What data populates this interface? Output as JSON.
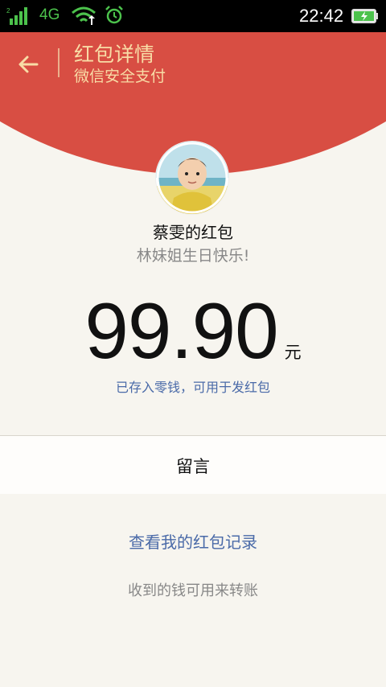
{
  "status_bar": {
    "network": "4G",
    "time": "22:42",
    "icons": [
      "signal-icon",
      "wifi-icon",
      "alarm-icon",
      "battery-charging-icon"
    ]
  },
  "header": {
    "title": "红包详情",
    "subtitle": "微信安全支付",
    "back_icon": "back-arrow-icon",
    "color": "#d84e43",
    "text_color": "#f8dca6"
  },
  "envelope": {
    "avatar": "avatar",
    "sender": "蔡雯的红包",
    "greeting": "林妹姐生日快乐!",
    "amount": "99.90",
    "unit": "元",
    "note": "已存入零钱，可用于发红包"
  },
  "message_section": {
    "title": "留言"
  },
  "footer": {
    "record_link": "查看我的红包记录",
    "hint": "收到的钱可用来转账"
  },
  "colors": {
    "link": "#4a6aa8",
    "background": "#f7f5ef"
  }
}
